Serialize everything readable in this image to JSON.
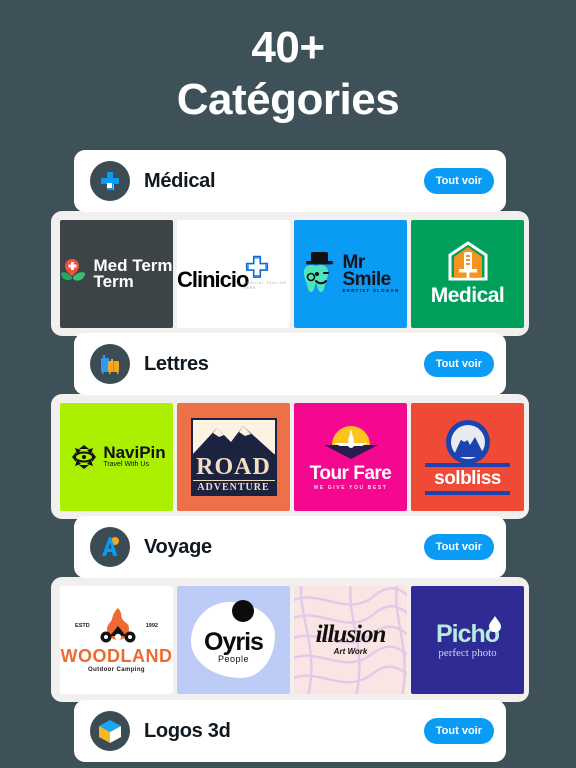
{
  "headline": {
    "line1": "40+",
    "line2": "Catégories"
  },
  "theme": {
    "background": "#3e5159",
    "card": "#ffffff",
    "strip": "#f2f0ee",
    "accent": "#0a9bf5",
    "icon_circle": "#3b4c55"
  },
  "see_all_label": "Tout voir",
  "categories": [
    {
      "title": "Médical",
      "icon": "medical-cross-icon",
      "logos": [
        {
          "name": "Med Term",
          "sub": "",
          "bg": "#3c4448",
          "icon": "flower-cross-icon"
        },
        {
          "name": "Clinicio",
          "sub": "MEDICAL TAGLINE HERE",
          "bg": "#ffffff",
          "icon": "blue-cross-icon"
        },
        {
          "name": "Mr Smile",
          "sub": "DENTIST SLOGAN",
          "bg": "#0a9bf5",
          "icon": "tooth-tophat-icon"
        },
        {
          "name": "Medical",
          "sub": "",
          "bg": "#00a05a",
          "icon": "syringe-house-icon"
        }
      ]
    },
    {
      "title": "Lettres",
      "icon": "luggage-icon",
      "logos": [
        {
          "name": "NaviPin",
          "sub": "Travel With Us",
          "bg": "#aaf000",
          "icon": "compass-icon"
        },
        {
          "name": "ROAD",
          "sub": "ADVENTURE",
          "bg": "#ec7048",
          "icon": "mountain-icon"
        },
        {
          "name": "Tour Fare",
          "sub": "WE GIVE YOU BEST",
          "bg": "#f5078f",
          "icon": "sunset-plane-icon"
        },
        {
          "name": "solbliss",
          "sub": "",
          "bg": "#ef4a36",
          "icon": "mountain-circle-icon"
        }
      ]
    },
    {
      "title": "Voyage",
      "icon": "letter-a-icon",
      "logos": [
        {
          "name": "WOODLAND",
          "sub": "Outdoor Camping",
          "bg": "#ffffff",
          "icon": "campfire-icon",
          "estd": "ESTD",
          "year": "1992"
        },
        {
          "name": "Oyris",
          "sub": "People",
          "bg": "#bcccf7",
          "icon": "blob-icon"
        },
        {
          "name": "illusion",
          "sub": "Art Work",
          "bg": "#fbe4e4",
          "icon": "wave-pattern-icon"
        },
        {
          "name": "Picho",
          "sub": "perfect photo",
          "bg": "#2e2b94",
          "icon": "droplet-icon"
        }
      ]
    },
    {
      "title": "Logos 3d",
      "icon": "cube-3d-icon",
      "logos": []
    }
  ]
}
